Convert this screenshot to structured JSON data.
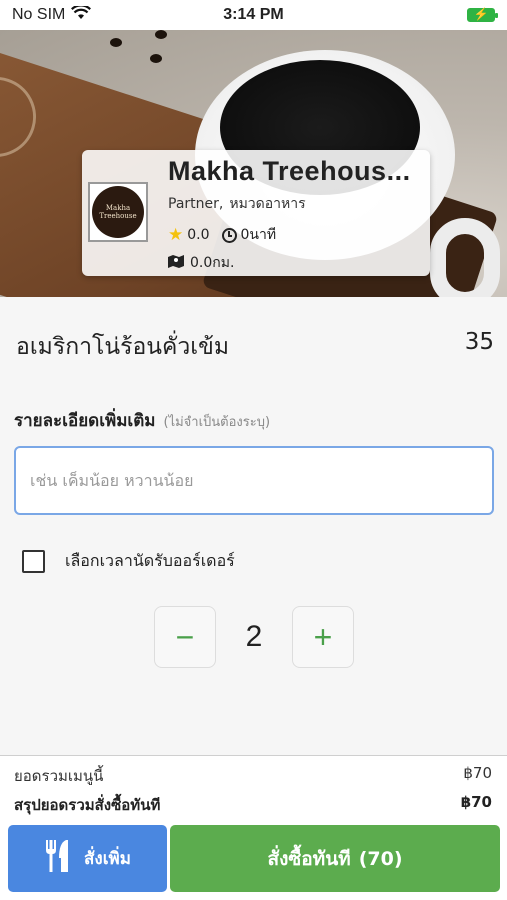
{
  "status_bar": {
    "carrier": "No SIM",
    "time": "3:14 PM",
    "battery_glyph": "⚡"
  },
  "shop": {
    "name": "Makha Treehous...",
    "logo_text": "Makha Treehouse",
    "type": "Partner,",
    "category": "หมวดอาหาร",
    "rating": "0.0",
    "time": "0นาที",
    "distance": "0.0กม."
  },
  "item": {
    "name": "อเมริกาโน่ร้อนคั่วเข้ม",
    "price": "35"
  },
  "details": {
    "label": "รายละเอียดเพิ่มเติม",
    "optional": "(ไม่จำเป็นต้องระบุ)",
    "placeholder": "เช่น เค็มน้อย หวานน้อย"
  },
  "schedule": {
    "label": "เลือกเวลานัดรับออร์เดอร์",
    "checked": false
  },
  "quantity": {
    "minus": "−",
    "value": "2",
    "plus": "+"
  },
  "summary": {
    "menu_total_label": "ยอดรวมเมนูนี้",
    "menu_total_value": "฿70",
    "order_total_label": "สรุปยอดรวมสั่งซื้อทันที",
    "order_total_value": "฿70"
  },
  "buttons": {
    "add_more": "สั่งเพิ่ม",
    "order_now": "สั่งซื้อทันที",
    "order_amount": "(70)"
  },
  "colors": {
    "accent_blue": "#4a87e0",
    "accent_green": "#5cac4e",
    "input_border": "#7aa7e6"
  }
}
